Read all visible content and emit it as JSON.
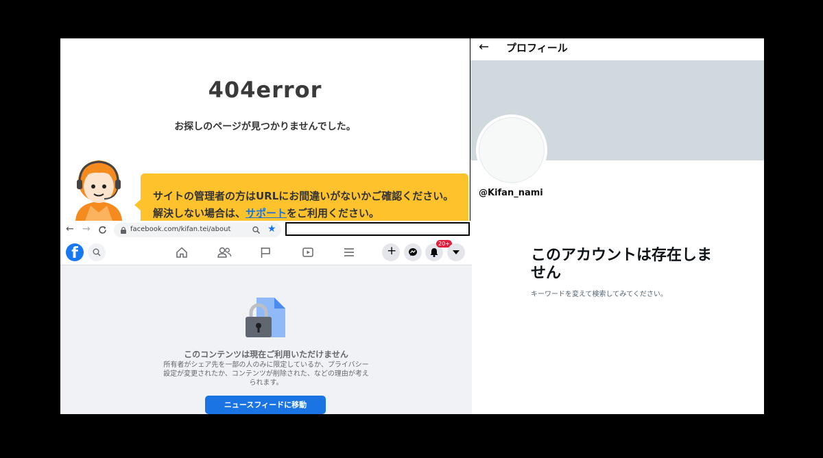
{
  "error_page": {
    "title": "404error",
    "subtitle": "お探しのページが見つかりませんでした。",
    "bubble_line1": "サイトの管理者の方はURLにお間違いがないかご確認ください。",
    "bubble_line2_pre": "解決しない場合は、",
    "bubble_link": "サポート",
    "bubble_line2_post": "をご利用ください。"
  },
  "twitter": {
    "back_icon": "back-arrow-icon",
    "header": "プロフィール",
    "handle": "@Kifan_nami",
    "notice_title": "このアカウントは存在しません",
    "notice_hint": "キーワードを変えて検索してみてください。",
    "banner_color": "#cfd9de"
  },
  "browser": {
    "url": "facebook.com/kifan.tei/about"
  },
  "facebook": {
    "notification_badge": "20+",
    "unavailable_title": "このコンテンツは現在ご利用いただけません",
    "unavailable_desc": "所有者がシェア先を一部の人のみに限定しているか、プライバシー設定が変更されたか、コンテンツが削除された、などの理由が考えられます。",
    "news_feed_button": "ニュースフィードに移動",
    "brand_color": "#1877f2"
  }
}
